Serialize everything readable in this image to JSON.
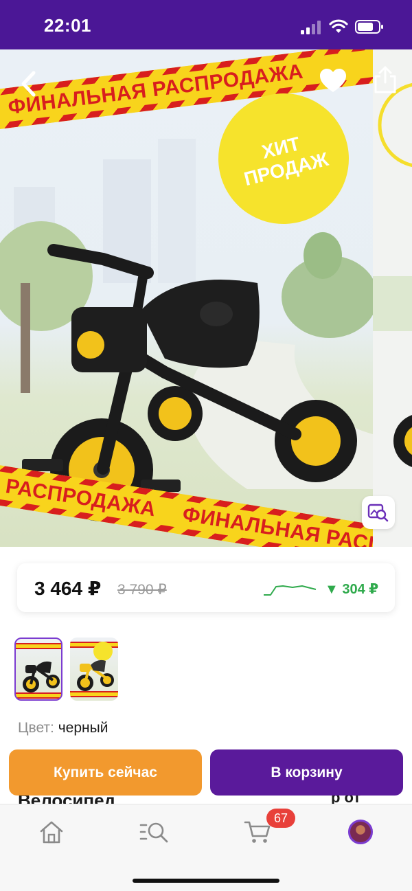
{
  "status_bar": {
    "time": "22:01"
  },
  "hero": {
    "top_tape_text": "ФИНАЛЬНАЯ РАСПРОДАЖА",
    "bottom_tape_text_1": "РАСПРОДАЖА",
    "bottom_tape_text_2": "ФИНАЛЬНАЯ РАСПРОДАЖА",
    "badge_text": "ХИТ\nПРОДАЖ",
    "icons": [
      "back-chevron-icon",
      "heart-icon",
      "share-icon",
      "visual-search-icon"
    ]
  },
  "price": {
    "current": "3 464 ₽",
    "old": "3 790 ₽",
    "drop": "▼ 304 ₽",
    "drop_color": "#2faa4c"
  },
  "product": {
    "color_label": "Цвет:",
    "color_value": "черный",
    "title_peek": "Велосипед",
    "right_peek": "р от"
  },
  "actions": {
    "buy_now_label": "Купить сейчас",
    "buy_now_color": "#f2992e",
    "to_cart_label": "В корзину",
    "to_cart_color": "#5a1a9b"
  },
  "tab_bar": {
    "items": [
      "home-icon",
      "catalog-search-icon",
      "cart-icon",
      "profile-avatar"
    ],
    "cart_count": "67"
  },
  "theme": {
    "brand_purple": "#4b1796",
    "accent_yellow": "#f8d41c",
    "tape_red": "#d81e1e"
  }
}
